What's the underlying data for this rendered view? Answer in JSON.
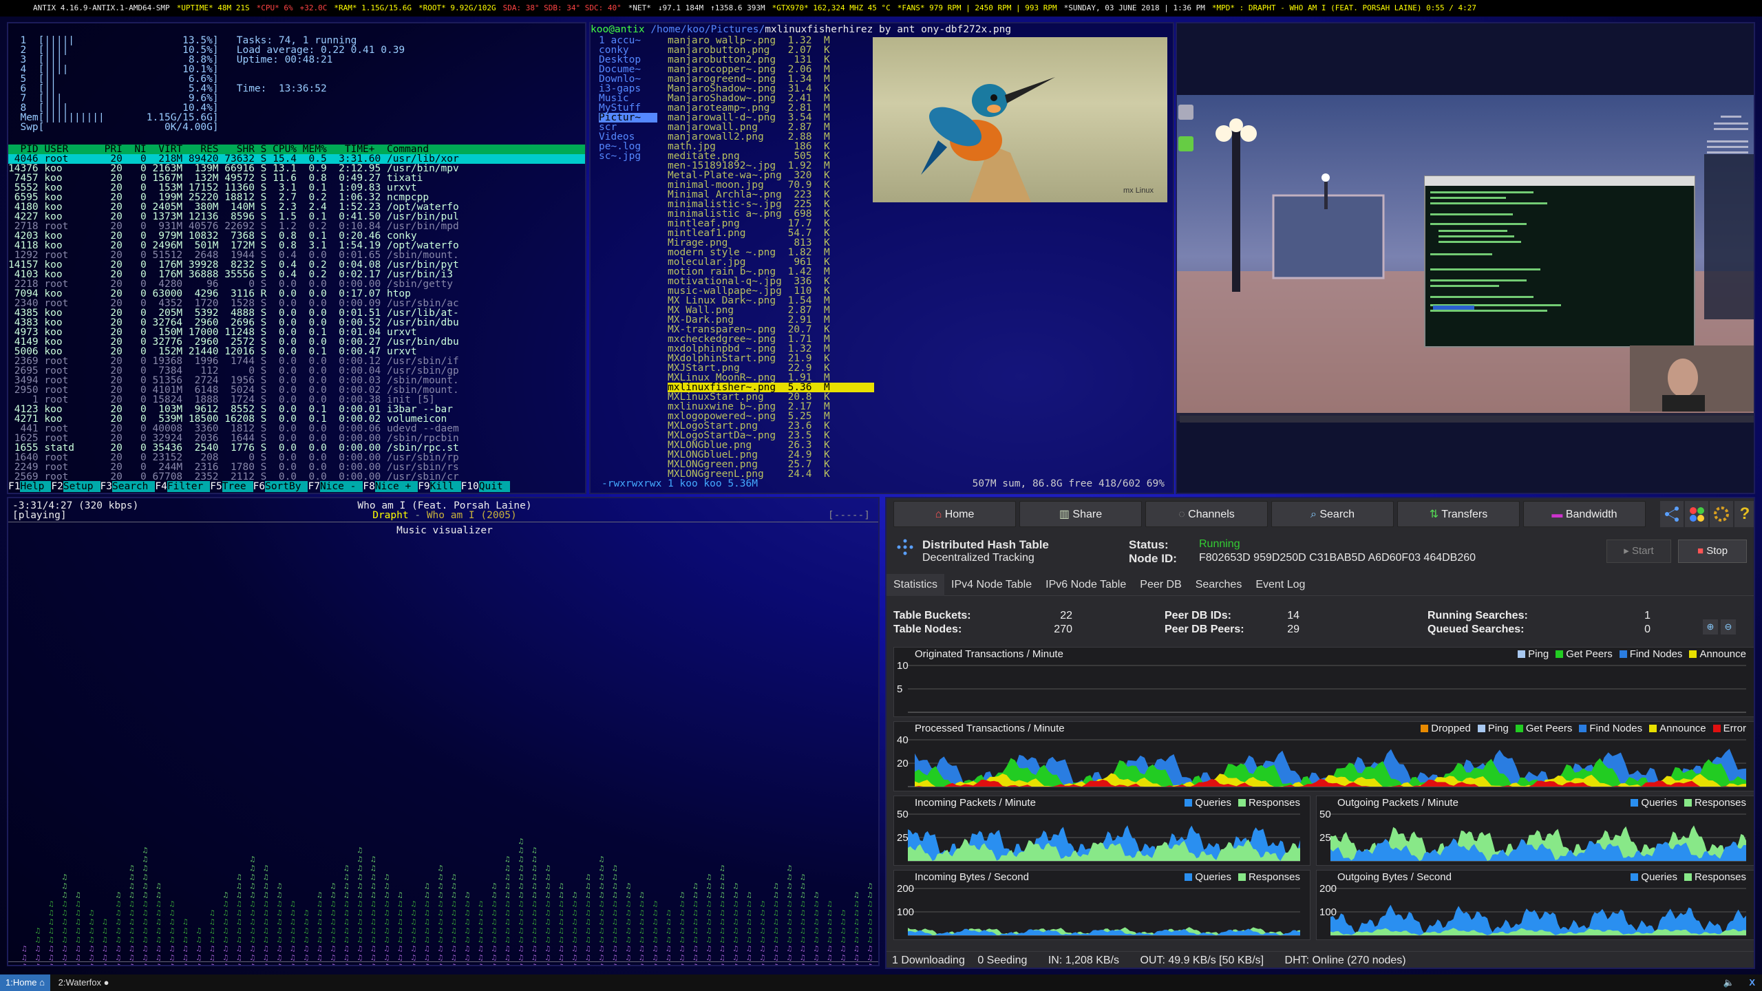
{
  "topbar": {
    "items": [
      {
        "t": "ANTIX 4.16.9-ANTIX.1-AMD64-SMP",
        "c": "w"
      },
      {
        "t": "*UPTIME* 48M 21S",
        "c": "y"
      },
      {
        "t": "*CPU* 6%",
        "c": "r"
      },
      {
        "t": "+32.0C",
        "c": "r"
      },
      {
        "t": "*RAM* 1.15G/15.6G",
        "c": "y"
      },
      {
        "t": "*ROOT* 9.92G/102G",
        "c": "y"
      },
      {
        "t": "SDA: 38° SDB: 34° SDC: 40°",
        "c": "r"
      },
      {
        "t": "*NET*",
        "c": "w"
      },
      {
        "t": "↓97.1  184M",
        "c": "w"
      },
      {
        "t": "↑1358.6  393M",
        "c": "w"
      },
      {
        "t": "*GTX970* 162,324 MHZ 45 °C",
        "c": "y"
      },
      {
        "t": "*FANS* 979 RPM | 2450 RPM | 993 RPM",
        "c": "y"
      },
      {
        "t": "*SUNDAY, 03 JUNE 2018 | 1:36 PM",
        "c": "w"
      },
      {
        "t": "*MPD* : DRAPHT - WHO AM I (FEAT. PORSAH LAINE) 0:55 / 4:27",
        "c": "y"
      }
    ]
  },
  "htop": {
    "cpu_rows": [
      "  1  [|||||                  13.5%]   Tasks: 74, 1 running",
      "  2  [||||                   10.5%]   Load average: 0.22 0.41 0.39",
      "  3  [|||                     8.8%]   Uptime: 00:48:21",
      "  4  [||||                   10.1%]",
      "  5  [||                      6.6%]",
      "  6  [||                      5.4%]   Time:  13:36:52",
      "  7  [|||                     9.6%]",
      "  8  [||||                   10.4%]",
      "  Mem[||||||||||       1.15G/15.6G]",
      "  Swp[                    0K/4.00G]"
    ],
    "header": "  PID USER      PRI  NI  VIRT   RES   SHR S CPU% MEM%   TIME+  Command",
    "processes": [
      " 4046 root       20   0  218M 89420 73632 S 15.4  0.5  3:31.60 /usr/lib/xor",
      "14376 koo        20   0 2163M  139M 66916 S 13.1  0.9  2:12.95 /usr/bin/mpv",
      " 7457 koo        20   0 1567M  132M 49572 S 11.6  0.8  0:49.27 tixati",
      " 5552 koo        20   0  153M 17152 11360 S  3.1  0.1  1:09.83 urxvt",
      " 6595 koo        20   0  199M 25220 18812 S  2.7  0.2  1:06.32 ncmpcpp",
      " 4180 koo        20   0 2405M  380M  140M S  2.3  2.4  1:52.23 /opt/waterfo",
      " 4227 koo        20   0 1373M 12136  8596 S  1.5  0.1  0:41.50 /usr/bin/pul",
      " 2718 root       20   0  931M 40576 22692 S  1.2  0.2  0:10.84 /usr/bin/mpd",
      " 4203 koo        20   0  979M 10832  7368 S  0.8  0.1  0:20.46 conky",
      " 4118 koo        20   0 2496M  501M  172M S  0.8  3.1  1:54.19 /opt/waterfo",
      " 1292 root       20   0 51512  2648  1944 S  0.4  0.0  0:01.65 /sbin/mount.",
      "14157 koo        20   0  176M 39928  8232 S  0.4  0.2  0:04.08 /usr/bin/pyt",
      " 4103 koo        20   0  176M 36888 35556 S  0.4  0.2  0:02.17 /usr/bin/i3",
      " 2218 root       20   0  4280    96     0 S  0.0  0.0  0:00.00 /sbin/getty",
      " 7094 koo        20   0 63000  4296  3116 R  0.0  0.0  0:17.07 htop",
      " 2340 root       20   0  4352  1720  1528 S  0.0  0.0  0:00.09 /usr/sbin/ac",
      " 4385 koo        20   0  205M  5392  4888 S  0.0  0.0  0:01.51 /usr/lib/at-",
      " 4383 koo        20   0 32764  2960  2696 S  0.0  0.0  0:00.52 /usr/bin/dbu",
      " 4973 koo        20   0  150M 17000 11248 S  0.0  0.1  0:01.04 urxvt",
      " 4149 koo        20   0 32776  2960  2572 S  0.0  0.0  0:00.27 /usr/bin/dbu",
      " 5006 koo        20   0  152M 21440 12016 S  0.0  0.1  0:00.47 urxvt",
      " 2369 root       20   0 19368  1996  1744 S  0.0  0.0  0:00.12 /usr/sbin/if",
      " 2695 root       20   0  7384   112     0 S  0.0  0.0  0:00.04 /usr/sbin/gp",
      " 3494 root       20   0 51356  2724  1956 S  0.0  0.0  0:00.03 /sbin/mount.",
      " 2950 root       20   0 4101M  6148  5024 S  0.0  0.0  0:00.02 /sbin/mount.",
      "    1 root       20   0 15824  1888  1724 S  0.0  0.0  0:00.38 init [5]",
      " 4123 koo        20   0  103M  9612  8552 S  0.0  0.1  0:00.01 i3bar --bar_",
      " 4271 koo        20   0  539M 18500 16208 S  0.0  0.1  0:00.02 volumeicon",
      "  441 root       20   0 40008  3360  1812 S  0.0  0.0  0:00.06 udevd --daem",
      " 1625 root       20   0 32924  2036  1644 S  0.0  0.0  0:00.00 /sbin/rpcbin",
      " 1655 statd      20   0 35436  2540  1776 S  0.0  0.0  0:00.00 /sbin/rpc.st",
      " 1640 root       20   0 23152   208     0 S  0.0  0.0  0:00.00 /usr/sbin/rp",
      " 2249 root       20   0  244M  2316  1780 S  0.0  0.0  0:00.00 /usr/sbin/rs",
      " 2569 root       20   0 67708  2352  2112 S  0.0  0.0  0:00.00 /usr/sbin/cr"
    ],
    "fkeys": [
      {
        "k": "F1",
        "l": "Help"
      },
      {
        "k": "F2",
        "l": "Setup"
      },
      {
        "k": "F3",
        "l": "Search"
      },
      {
        "k": "F4",
        "l": "Filter"
      },
      {
        "k": "F5",
        "l": "Tree"
      },
      {
        "k": "F6",
        "l": "SortBy"
      },
      {
        "k": "F7",
        "l": "Nice -"
      },
      {
        "k": "F8",
        "l": "Nice +"
      },
      {
        "k": "F9",
        "l": "Kill"
      },
      {
        "k": "F10",
        "l": "Quit"
      }
    ]
  },
  "fm": {
    "title_user": "koo@antix",
    "title_path": "/home/koo/Pictures/",
    "title_file": "mxlinuxfisherhirez_by_ant_ony-dbf272x.png",
    "dirs": [
      "1_accu~",
      "conky",
      "Desktop",
      "Docume~",
      "Downlo~",
      "i3-gaps",
      "Music",
      "MyStuff",
      "Pictur~",
      "scr",
      "Videos",
      "pe~.log",
      "sc~.jpg"
    ],
    "dir_selected": 8,
    "files": [
      "manjaro_wallp~.png  1.32  M",
      "manjarobutton.png   2.07  K",
      "manjarobutton2.png   131  K",
      "manjarocopper~.png  2.06  M",
      "manjarogreend~.png  1.34  M",
      "ManjaroShadow~.png  31.4  K",
      "ManjaroShadow~.png  2.41  M",
      "manjaroteamp~.png   2.81  M",
      "manjarowall-d~.png  3.54  M",
      "manjarowall.png     2.87  M",
      "manjarowall2.png    2.88  M",
      "math.jpg             186  K",
      "meditate.png         505  K",
      "men-151891892~.jpg  1.92  M",
      "Metal-Plate-wa~.png  320  K",
      "minimal-moon.jpg    70.9  K",
      "Minimal_Archla~.png  223  K",
      "minimalistic-s~.jpg  225  K",
      "minimalistic_a~.png  698  K",
      "mintleaf.png        17.7  K",
      "mintleaf1.png       54.7  K",
      "Mirage.png           813  K",
      "modern_style_~.png  1.82  M",
      "molecular.jpg        961  K",
      "motion_rain_b~.png  1.42  M",
      "motivational-q~.jpg  336  K",
      "music-wallpape~.jpg  110  K",
      "MX Linux Dark~.png  1.54  M",
      "MX_Wall.png         2.87  M",
      "MX-Dark.png         2.91  M",
      "MX-transparen~.png  20.7  K",
      "mxcheckedgree~.png  1.71  M",
      "mxdolphinpbd_~.png  1.32  M",
      "MXdolphinStart.png  21.9  K",
      "MXJStart.png        22.9  K",
      "MXLinux_MoonR~.png  1.91  M",
      "mxlinuxfisher~.png  5.36  M",
      "MXLinuxStart.png    20.8  K",
      "mxlinuxwine_b~.png  2.17  M",
      "mxlogopowered~.png  5.25  M",
      "MXLogoStart.png     23.6  K",
      "MXLogoStartDa~.png  23.5  K",
      "MXLONGblue.png      26.3  K",
      "MXLONGblueL.png     24.9  K",
      "MXLONGgreen.png     25.7  K",
      "MXLONGgreenL.png    24.4  K"
    ],
    "file_selected": 36,
    "status_left": "-rwxrwxrwx 1 koo koo 5.36M",
    "status_right": "507M sum, 86.8G free  418/602  69%",
    "preview_watermark": "mx Linux"
  },
  "music": {
    "time": "-3:31/4:27 (320 kbps)",
    "state": "[playing]",
    "title": "Who am I (Feat. Porsah Laine)",
    "artist": "Drapht",
    "album_year": "Who am I (2005)",
    "flags": "[-----]",
    "visualizer_label": "Music visualizer"
  },
  "tixati": {
    "nav": [
      {
        "label": "Home",
        "icon": "home-icon"
      },
      {
        "label": "Share",
        "icon": "share-icon"
      },
      {
        "label": "Channels",
        "icon": "channels-icon"
      },
      {
        "label": "Search",
        "icon": "search-icon"
      },
      {
        "label": "Transfers",
        "icon": "transfers-icon"
      },
      {
        "label": "Bandwidth",
        "icon": "bandwidth-icon"
      }
    ],
    "dht_title": "Distributed Hash Table",
    "dht_sub": "Decentralized Tracking",
    "status_label": "Status:",
    "status_value": "Running",
    "node_label": "Node ID:",
    "node_value": "F802653D 959D250D C31BAB5D A6D60F03 464DB260",
    "start_label": "Start",
    "stop_label": "Stop",
    "tabs": [
      "Statistics",
      "IPv4 Node Table",
      "IPv6 Node Table",
      "Peer DB",
      "Searches",
      "Event Log"
    ],
    "stats": [
      {
        "label": "Table Buckets:",
        "value": "22"
      },
      {
        "label": "Table Nodes:",
        "value": "270"
      },
      {
        "label": "Peer DB IDs:",
        "value": "14"
      },
      {
        "label": "Peer DB Peers:",
        "value": "29"
      },
      {
        "label": "Running Searches:",
        "value": "1"
      },
      {
        "label": "Queued Searches:",
        "value": "0"
      }
    ],
    "colors": {
      "ping": "#a8c8f0",
      "getpeers": "#22cc22",
      "findnodes": "#2a7de1",
      "announce": "#e8e000",
      "dropped": "#e88a00",
      "error": "#e01010",
      "queries": "#2a8ff0",
      "responses": "#88e888"
    },
    "charts": {
      "orig": {
        "title": "Originated Transactions / Minute",
        "legend": [
          "Ping",
          "Get Peers",
          "Find Nodes",
          "Announce"
        ],
        "ticks": [
          "10",
          "5"
        ]
      },
      "proc": {
        "title": "Processed Transactions / Minute",
        "legend": [
          "Dropped",
          "Ping",
          "Get Peers",
          "Find Nodes",
          "Announce",
          "Error"
        ],
        "ticks": [
          "40",
          "20"
        ]
      },
      "inpk": {
        "title": "Incoming Packets / Minute",
        "legend": [
          "Queries",
          "Responses"
        ],
        "ticks": [
          "50",
          "25"
        ]
      },
      "outpk": {
        "title": "Outgoing Packets / Minute",
        "legend": [
          "Queries",
          "Responses"
        ],
        "ticks": [
          "50",
          "25"
        ]
      },
      "inby": {
        "title": "Incoming Bytes / Second",
        "legend": [
          "Queries",
          "Responses"
        ],
        "ticks": [
          "200",
          "100"
        ]
      },
      "outby": {
        "title": "Outgoing Bytes / Second",
        "legend": [
          "Queries",
          "Responses"
        ],
        "ticks": [
          "200",
          "100"
        ]
      }
    },
    "statusbar": {
      "downloading": "1 Downloading",
      "seeding": "0 Seeding",
      "in": "IN: 1,208 KB/s",
      "out": "OUT: 49.9 KB/s [50 KB/s]",
      "dht": "DHT: Online (270 nodes)"
    }
  },
  "taskbar": {
    "ws1": "1:Home",
    "ws2": "2:Waterfox"
  }
}
